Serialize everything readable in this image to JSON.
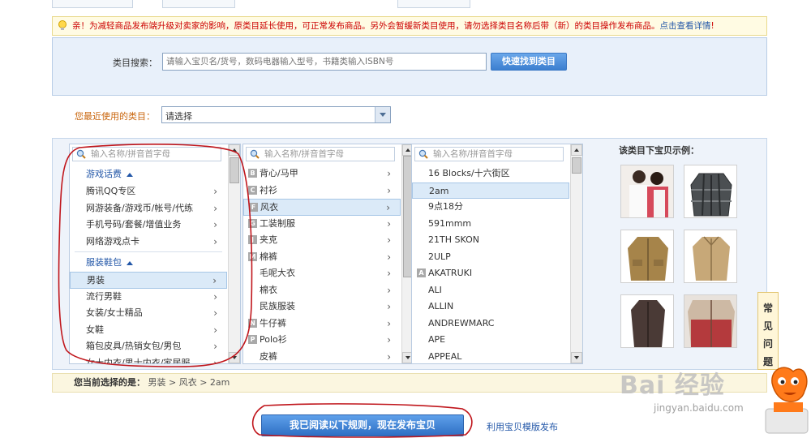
{
  "notice": {
    "text": "亲！为减轻商品发布端升级对卖家的影响，原类目延长使用，可正常发布商品。另外会暂缓新类目使用，请勿选择类目名称后带（新）的类目操作发布商品。",
    "link": "点击查看详情",
    "tail": "!"
  },
  "search": {
    "label": "类目搜索：",
    "placeholder": "请输入宝贝名/货号，数码电器输入型号，书籍类输入ISBN号",
    "button": "快速找到类目"
  },
  "recent": {
    "label": "您最近使用的类目：",
    "value": "请选择"
  },
  "columns": {
    "search_placeholder": "输入名称/拼音首字母",
    "col1": {
      "group1": "游戏话费",
      "group1_items": [
        "腾讯QQ专区",
        "网游装备/游戏币/帐号/代练",
        "手机号码/套餐/增值业务",
        "网络游戏点卡"
      ],
      "group2": "服装鞋包",
      "group2_items": [
        "男装",
        "流行男鞋",
        "女装/女士精品",
        "女鞋",
        "箱包皮具/热销女包/男包",
        "女士内衣/男士内衣/家居服"
      ]
    },
    "col2": {
      "items": [
        {
          "letter": "B",
          "label": "背心/马甲"
        },
        {
          "letter": "C",
          "label": "衬衫"
        },
        {
          "letter": "F",
          "label": "风衣"
        },
        {
          "letter": "G",
          "label": "工装制服"
        },
        {
          "letter": "J",
          "label": "夹克"
        },
        {
          "letter": "M",
          "label": "棉裤"
        },
        {
          "letter": "",
          "label": "毛呢大衣"
        },
        {
          "letter": "",
          "label": "棉衣"
        },
        {
          "letter": "",
          "label": "民族服装"
        },
        {
          "letter": "N",
          "label": "牛仔裤"
        },
        {
          "letter": "P",
          "label": "Polo衫"
        },
        {
          "letter": "",
          "label": "皮裤"
        }
      ]
    },
    "col3": {
      "items": [
        {
          "letter": "",
          "label": "16 Blocks/十六街区"
        },
        {
          "letter": "",
          "label": "2am"
        },
        {
          "letter": "",
          "label": "9点18分"
        },
        {
          "letter": "",
          "label": "591mmm"
        },
        {
          "letter": "",
          "label": "21TH SKON"
        },
        {
          "letter": "",
          "label": "2ULP"
        },
        {
          "letter": "A",
          "label": "AKATRUKI"
        },
        {
          "letter": "",
          "label": "ALI"
        },
        {
          "letter": "",
          "label": "ALLIN"
        },
        {
          "letter": "",
          "label": "ANDREWMARC"
        },
        {
          "letter": "",
          "label": "APE"
        },
        {
          "letter": "",
          "label": "APPEAL"
        }
      ]
    }
  },
  "examples": {
    "label": "该类目下宝贝示例："
  },
  "faq": {
    "chars": [
      "常",
      "见",
      "问",
      "题"
    ]
  },
  "current": {
    "label": "您当前选择的是：",
    "path": "男装 > 风衣 > 2am"
  },
  "publish_button": "我已阅读以下规则，现在发布宝贝",
  "template_link": "利用宝贝模版发布",
  "watermark": {
    "text": "Bai 经验",
    "sub": "jingyan.baidu.com"
  },
  "colors": {
    "accent": "#3c7fd0",
    "notice_red": "#cc0000",
    "link_blue": "#2357a8",
    "annotation_red": "#c0161c"
  }
}
